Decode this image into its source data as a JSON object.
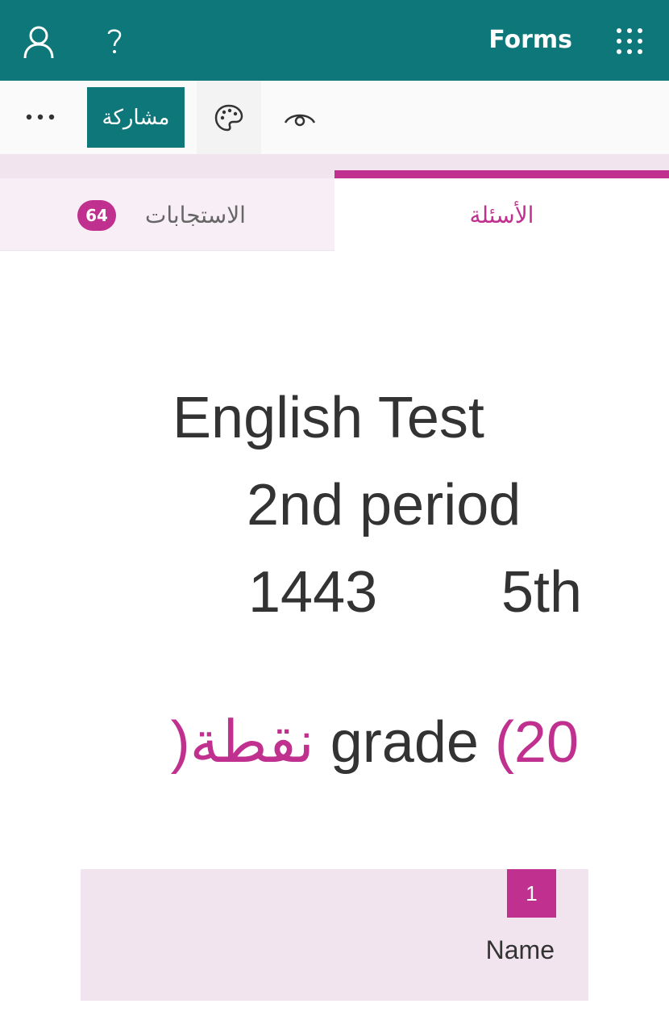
{
  "header": {
    "app_title": "Forms",
    "background": "#0e777a",
    "icons": [
      "profile-icon",
      "help-icon",
      "app-launcher-icon"
    ]
  },
  "toolbar": {
    "share_label": "مشاركة",
    "icons": [
      "more-icon",
      "theme-palette-icon",
      "preview-eye-icon"
    ]
  },
  "tabs": {
    "questions_label": "الأسئلة",
    "responses_label": "الاستجابات",
    "responses_count": "64",
    "active": "questions"
  },
  "form": {
    "title_line1": "English Test",
    "title_line2": "2nd period",
    "title_line3_left": "1443",
    "title_line3_right": "5th",
    "title_line4_points": "(20 نقطة)",
    "title_line4_grade": "grade"
  },
  "questions": [
    {
      "number": "1",
      "label": "Name"
    }
  ],
  "colors": {
    "accent": "#c0318f",
    "brand": "#0e777a",
    "card_bg": "#f1e4ee"
  }
}
